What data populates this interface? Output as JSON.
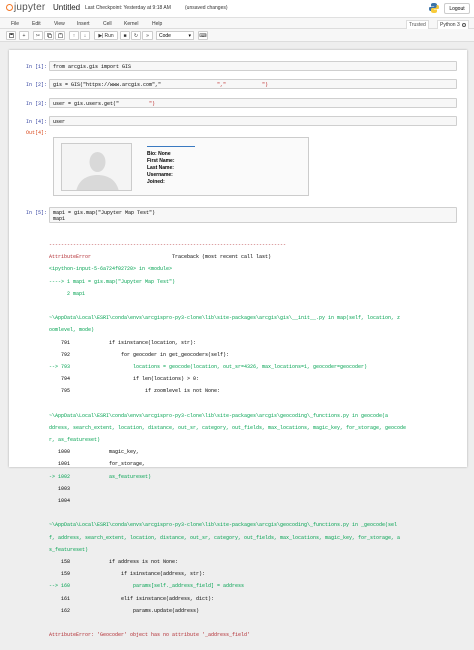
{
  "header": {
    "logo_text": "jupyter",
    "title": "Untitled",
    "checkpoint": "Last Checkpoint: Yesterday at 9:18 AM",
    "unsaved": "(unsaved changes)",
    "logout": "Logout"
  },
  "menu": [
    "File",
    "Edit",
    "View",
    "Insert",
    "Cell",
    "Kernel",
    "Help"
  ],
  "status": {
    "trusted": "Trusted",
    "kernel": "Python 3"
  },
  "toolbar": {
    "run_label": "Run",
    "cell_type": "Code"
  },
  "cells": [
    {
      "prompt": "In [1]:",
      "code": "from arcgis.gis import GIS"
    },
    {
      "prompt": "In [2]:",
      "code_a": "gis = GIS(\"https://www.arcgis.com\",\"",
      "code_b": "\",\"",
      "code_c": "\")"
    },
    {
      "prompt": "In [3]:",
      "code_a": "user = gis.users.get(\"",
      "code_b": "\")"
    },
    {
      "prompt": "In [4]:",
      "code": "user"
    },
    {
      "prompt": "Out[4]:"
    },
    {
      "prompt": "In [5]:",
      "code_l1": "map1 = gis.map(\"Jupyter Map Test\")",
      "code_l2": "map1"
    }
  ],
  "user_card": {
    "bio": "Bio: None",
    "first_name": "First Name:",
    "last_name": "Last Name:",
    "username": "Username:",
    "joined": "Joined:"
  },
  "traceback": {
    "divider": "-------------------------------------------------------------------------------",
    "error_name": "AttributeError",
    "trace_head": "Traceback (most recent call last)",
    "l1": "<ipython-input-5-6a724f02720> in <module>",
    "l2": "----> 1 map1 = gis.map(\"Jupyter Map Test\")",
    "l3": "      2 map1",
    "l4": "~\\AppData\\Local\\ESRI\\conda\\envs\\arcgispro-py3-clone\\lib\\site-packages\\arcgis\\gis\\__init__.py in map(self, location, z",
    "l5": "oomlevel, mode)",
    "l6": "    791             if isinstance(location, str):",
    "l7": "    792                 for geocoder in get_geocoders(self):",
    "l8": "--> 793                     locations = geocode(location, out_sr=4326, max_locations=1, geocoder=geocoder)",
    "l9": "    794                     if len(locations) > 0:",
    "l10": "    795                         if zoomlevel is not None:",
    "l11": "~\\AppData\\Local\\ESRI\\conda\\envs\\arcgispro-py3-clone\\lib\\site-packages\\arcgis\\geocoding\\_functions.py in geocode(a",
    "l12": "ddress, search_extent, location, distance, out_sr, category, out_fields, max_locations, magic_key, for_storage, geocode",
    "l13": "r, as_featureset)",
    "l14": "   1000             magic_key,",
    "l15": "   1001             for_storage,",
    "l16": "-> 1002             as_featureset)",
    "l17": "   1003",
    "l18": "   1004",
    "l19": "~\\AppData\\Local\\ESRI\\conda\\envs\\arcgispro-py3-clone\\lib\\site-packages\\arcgis\\geocoding\\_functions.py in _geocode(sel",
    "l20": "f, address, search_extent, location, distance, out_sr, category, out_fields, max_locations, magic_key, for_storage, a",
    "l21": "s_featureset)",
    "l22": "    158             if address is not None:",
    "l23": "    159                 if isinstance(address, str):",
    "l24": "--> 160                     params[self._address_field] = address",
    "l25": "    161                 elif isinstance(address, dict):",
    "l26": "    162                     params.update(address)",
    "final": "AttributeError: 'Geocoder' object has no attribute '_address_field'"
  },
  "colors": {
    "accent": "#f37726",
    "prompt_in": "#303f9f",
    "prompt_out": "#d84315",
    "error": "#b22b31"
  }
}
